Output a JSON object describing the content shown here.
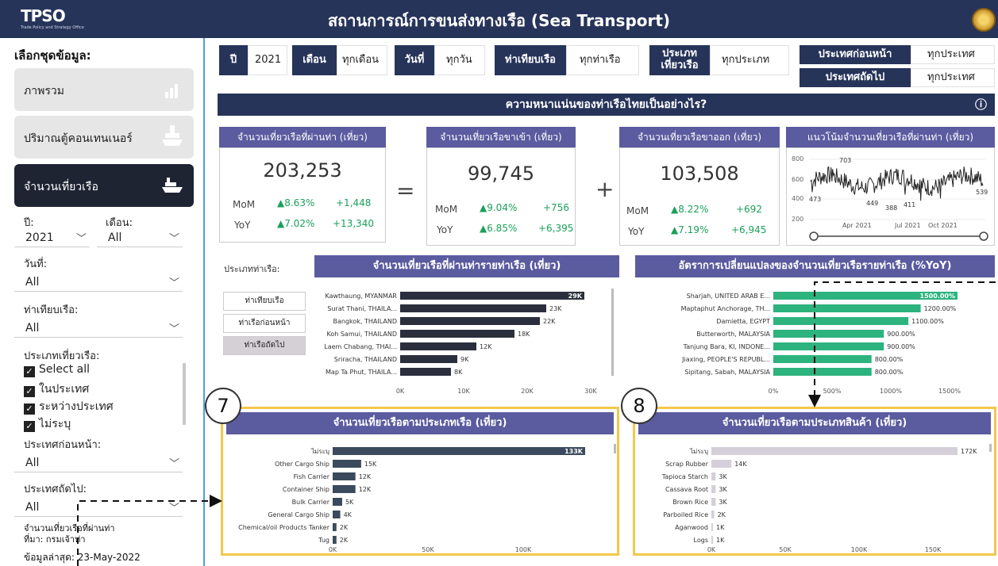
{
  "app": {
    "logo": "TPSO",
    "logo_sub": "Trade Policy and Strategy Office",
    "title": "สถานการณ์การขนส่งทางเรือ (Sea Transport)"
  },
  "sidebar": {
    "heading": "เลือกชุดข้อมูล:",
    "nav": [
      {
        "label": "ภาพรวม",
        "icon": "bar-chart-icon"
      },
      {
        "label": "ปริมาณตู้คอนเทนเนอร์",
        "icon": "container-ship-icon"
      },
      {
        "label": "จำนวนเที่ยวเรือ",
        "icon": "ship-icon"
      }
    ],
    "filters": {
      "year_label": "ปี:",
      "year_value": "2021",
      "month_label": "เดือน:",
      "month_value": "All",
      "day_label": "วันที่:",
      "day_value": "All",
      "port_label": "ท่าเทียบเรือ:",
      "port_value": "All",
      "trip_type_label": "ประเภทเที่ยวเรือ:",
      "trip_types": [
        "Select all",
        "ในประเทศ",
        "ระหว่างประเทศ",
        "ไม่ระบุ"
      ],
      "prev_country_label": "ประเทศก่อนหน้า:",
      "prev_country_value": "All",
      "next_country_label": "ประเทศถัดไป:",
      "next_country_value": "All"
    },
    "note_line1": "จำนวนเที่ยวเรือที่ผ่านท่า",
    "note_line2": "ที่มา: กรมเจ้าท่า",
    "updated": "ข้อมูลล่าสุด: 23-May-2022"
  },
  "filterbar": {
    "year_h": "ปี",
    "year_v": "2021",
    "month_h": "เดือน",
    "month_v": "ทุกเดือน",
    "day_h": "วันที่",
    "day_v": "ทุกวัน",
    "port_h": "ท่าเทียบเรือ",
    "port_v": "ทุกท่าเรือ",
    "type_h1": "ประเภท",
    "type_h2": "เที่ยวเรือ",
    "type_v": "ทุกประเภท",
    "prev_h": "ประเทศก่อนหน้า",
    "prev_v": "ทุกประเทศ",
    "next_h": "ประเทศถัดไป",
    "next_v": "ทุกประเทศ"
  },
  "section_title": "ความหนาแน่นของท่าเรือไทยเป็นอย่างไร?",
  "kpis": [
    {
      "title": "จำนวนเที่ยวเรือที่ผ่านท่า (เที่ยว)",
      "value": "203,253",
      "mom_pct": "▲8.63%",
      "mom_abs": "+1,448",
      "yoy_pct": "▲7.02%",
      "yoy_abs": "+13,340"
    },
    {
      "title": "จำนวนเที่ยวเรือขาเข้า (เที่ยว)",
      "value": "99,745",
      "mom_pct": "▲9.04%",
      "mom_abs": "+756",
      "yoy_pct": "▲6.85%",
      "yoy_abs": "+6,395"
    },
    {
      "title": "จำนวนเที่ยวเรือขาออก (เที่ยว)",
      "value": "103,508",
      "mom_pct": "▲8.22%",
      "mom_abs": "+692",
      "yoy_pct": "▲7.19%",
      "yoy_abs": "+6,945"
    }
  ],
  "mom_label": "MoM",
  "yoy_label": "YoY",
  "op_equals": "=",
  "op_plus": "+",
  "info_icon": "info-icon",
  "trend": {
    "title": "แนวโน้มจำนวนเที่ยวเรือที่ผ่านท่า (เที่ยว)",
    "yticks": [
      "800",
      "600",
      "400",
      "200"
    ],
    "xticks": [
      "Apr 2021",
      "Jul 2021",
      "Oct 2021"
    ],
    "annotations": [
      "703",
      "473",
      "449",
      "388",
      "411",
      "539"
    ]
  },
  "port_type_label": "ประเภทท่าเรือ:",
  "port_type_buttons": [
    "ท่าเทียบเรือ",
    "ท่าเรือก่อนหน้า",
    "ท่าเรือถัดไป"
  ],
  "tags": {
    "badge7": "7",
    "badge8": "8"
  },
  "chart_data": [
    {
      "type": "bar",
      "title": "จำนวนเที่ยวเรือที่ผ่านท่ารายท่าเรือ (เที่ยว)",
      "categories": [
        "Kawthaung, MYANMAR",
        "Surat Thani, THAILA...",
        "Bangkok, THAILAND",
        "Koh Samui, THAILAND",
        "Laem Chabang, THAI...",
        "Sriracha, THAILAND",
        "Map Ta Phut, THAILA..."
      ],
      "values": [
        29000,
        23000,
        22000,
        18000,
        12000,
        9000,
        8000
      ],
      "labels": [
        "29K",
        "23K",
        "22K",
        "18K",
        "12K",
        "9K",
        "8K"
      ],
      "xticks": [
        "0K",
        "10K",
        "20K",
        "30K"
      ],
      "xlim": [
        0,
        30000
      ],
      "color": "#2b2f3d"
    },
    {
      "type": "bar",
      "title": "อัตราการเปลี่ยนแปลงของจำนวนเที่ยวเรือรายท่าเรือ (%YoY)",
      "categories": [
        "Sharjah, UNITED ARAB E...",
        "Maptaphut Anchorage, TH...",
        "Damietta, EGYPT",
        "Butterworth, MALAYSIA",
        "Tanjung Bara, KI, INDONE...",
        "Jiaxing, PEOPLE'S REPUBL...",
        "Sipitang, Sabah, MALAYSIA"
      ],
      "values": [
        1500,
        1200,
        1100,
        900,
        900,
        800,
        800
      ],
      "labels": [
        "1500.00%",
        "1200.00%",
        "1100.00%",
        "900.00%",
        "900.00%",
        "800.00%",
        "800.00%"
      ],
      "xticks": [
        "0%",
        "500%",
        "1000%",
        "1500%"
      ],
      "xlim": [
        0,
        1500
      ],
      "color": "#2db37e"
    },
    {
      "type": "bar",
      "title": "จำนวนเที่ยวเรือตามประเภทเรือ (เที่ยว)",
      "categories": [
        "ไม่ระบุ",
        "Other Cargo Ship",
        "Fish Carrier",
        "Container Ship",
        "Bulk Carrier",
        "General Cargo Ship",
        "Chemical/oil Products Tanker",
        "Tug"
      ],
      "values": [
        133000,
        15000,
        12000,
        12000,
        5000,
        4000,
        2000,
        2000
      ],
      "labels": [
        "133K",
        "15K",
        "12K",
        "12K",
        "5K",
        "4K",
        "2K",
        "2K"
      ],
      "xticks": [
        "0K",
        "50K",
        "100K"
      ],
      "xlim": [
        0,
        133000
      ],
      "color": "#3b4a5c"
    },
    {
      "type": "bar",
      "title": "จำนวนเที่ยวเรือตามประเภทสินค้า (เที่ยว)",
      "categories": [
        "ไม่ระบุ",
        "Scrap Rubber",
        "Tapioca Starch",
        "Cassava Root",
        "Brown Rice",
        "Parboiled Rice",
        "Aganwood",
        "Logs"
      ],
      "values": [
        172000,
        14000,
        3000,
        3000,
        3000,
        2000,
        1000,
        1000
      ],
      "labels": [
        "172K",
        "14K",
        "3K",
        "3K",
        "3K",
        "2K",
        "1K",
        "1K"
      ],
      "xticks": [
        "0K",
        "50K",
        "100K",
        "150K"
      ],
      "xlim": [
        0,
        172000
      ],
      "color": "#d4cfd8"
    }
  ]
}
